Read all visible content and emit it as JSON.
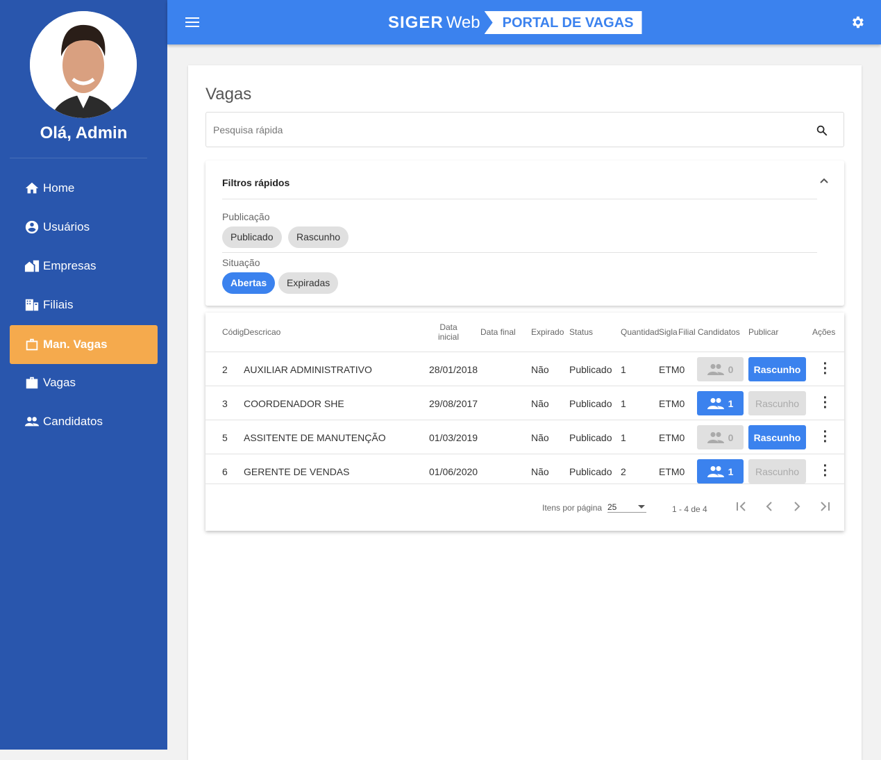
{
  "sidebar": {
    "greeting": "Olá, Admin",
    "items": [
      {
        "label": "Home",
        "icon": "home-icon"
      },
      {
        "label": "Usuários",
        "icon": "account-circle-icon"
      },
      {
        "label": "Empresas",
        "icon": "domain-icon"
      },
      {
        "label": "Filiais",
        "icon": "building-icon"
      },
      {
        "label": "Man. Vagas",
        "icon": "briefcase-outline-icon",
        "active": true
      },
      {
        "label": "Vagas",
        "icon": "briefcase-icon"
      },
      {
        "label": "Candidatos",
        "icon": "people-icon"
      }
    ]
  },
  "header": {
    "logo_siger": "SIGER",
    "logo_web": "Web",
    "portal": "PORTAL DE VAGAS"
  },
  "page": {
    "title": "Vagas",
    "search_placeholder": "Pesquisa rápida"
  },
  "filters": {
    "title": "Filtros rápidos",
    "publicacao_label": "Publicação",
    "publicacao_chips": [
      "Publicado",
      "Rascunho"
    ],
    "situacao_label": "Situação",
    "situacao_chips": [
      "Abertas",
      "Expiradas"
    ]
  },
  "table": {
    "headers": [
      "Códig",
      "Descricao",
      "Data inicial",
      "Data final",
      "Expirado",
      "Status",
      "Quantidad",
      "Sigla",
      "Filial",
      "Candidatos",
      "Publicar",
      "Ações"
    ],
    "rows": [
      {
        "cod": "2",
        "desc": "AUXILIAR ADMINISTRATIVO",
        "data": "28/01/2018",
        "exp": "Não",
        "status": "Publicado",
        "qtd": "1",
        "filial": "ETM0",
        "cand": "0",
        "pub": "Rascunho",
        "cand_on": false
      },
      {
        "cod": "3",
        "desc": "COORDENADOR SHE",
        "data": "29/08/2017",
        "exp": "Não",
        "status": "Publicado",
        "qtd": "1",
        "filial": "ETM0",
        "cand": "1",
        "pub": "Rascunho",
        "cand_on": true
      },
      {
        "cod": "5",
        "desc": "ASSITENTE DE MANUTENÇÃO",
        "data": "01/03/2019",
        "exp": "Não",
        "status": "Publicado",
        "qtd": "1",
        "filial": "ETM0",
        "cand": "0",
        "pub": "Rascunho",
        "cand_on": false
      },
      {
        "cod": "6",
        "desc": "GERENTE DE VENDAS",
        "data": "01/06/2020",
        "exp": "Não",
        "status": "Publicado",
        "qtd": "2",
        "filial": "ETM0",
        "cand": "1",
        "pub": "Rascunho",
        "cand_on": true
      }
    ]
  },
  "pagination": {
    "label": "Itens por página",
    "size": "25",
    "range": "1 - 4 de 4"
  }
}
